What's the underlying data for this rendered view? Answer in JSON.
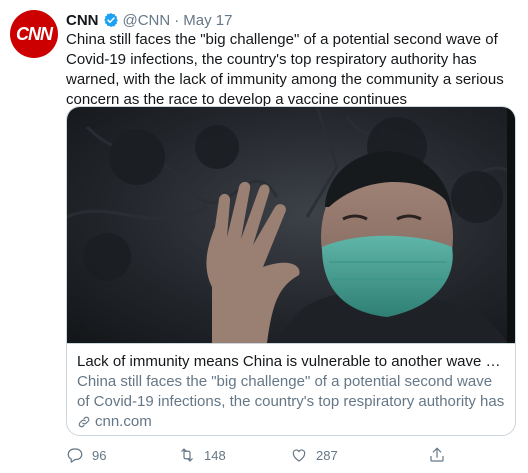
{
  "tweet": {
    "avatar_text": "CNN",
    "name": "CNN",
    "handle": "@CNN",
    "separator": "·",
    "date": "May 17",
    "text": "China still faces the \"big challenge\" of a potential second wave of Covid-19 infections, the country's top respiratory authority has warned, with the lack of immunity among the community a serious concern as the race to develop a vaccine continues",
    "card": {
      "title": "Lack of immunity means China is vulnerable to another wave of coro...",
      "description": "China still faces the \"big challenge\" of a potential second wave of Covid-19 infections, the country's top respiratory authority has warn...",
      "domain": "cnn.com"
    },
    "actions": {
      "replies": "96",
      "retweets": "148",
      "likes": "287"
    }
  },
  "colors": {
    "brand_red": "#cc0000",
    "verified_blue": "#1da1f2",
    "text_primary": "#14171a",
    "text_secondary": "#657786",
    "border": "#ccd6dd"
  },
  "icons": [
    "verified-badge-icon",
    "link-icon",
    "reply-icon",
    "retweet-icon",
    "like-icon",
    "share-icon"
  ]
}
